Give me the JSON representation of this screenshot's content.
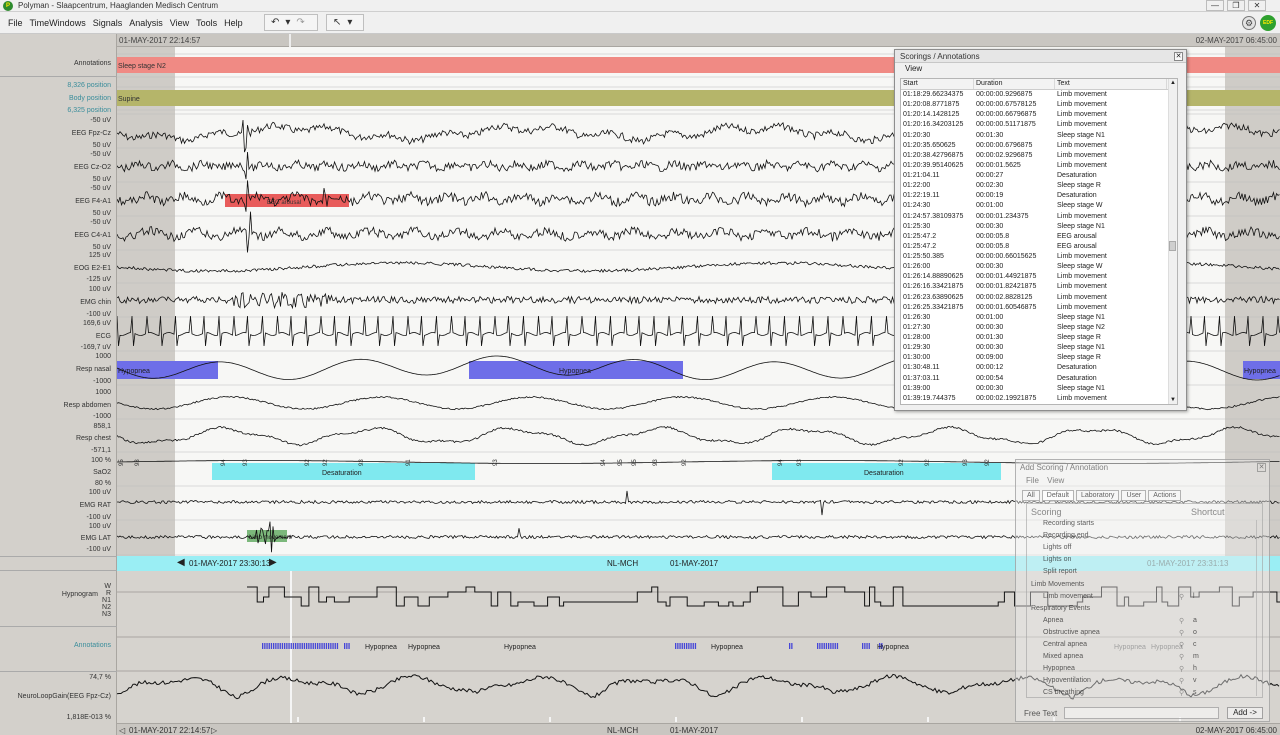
{
  "window": {
    "title": "Polyman - Slaapcentrum, Haaglanden Medisch Centrum",
    "minimize": "—",
    "maximize": "❐",
    "close": "✕"
  },
  "menu": [
    "File",
    "TimeWindows",
    "Signals",
    "Analysis",
    "View",
    "Tools",
    "Help"
  ],
  "toolbar": {
    "undo": "↶",
    "dropdown": "▾",
    "redo": "↷",
    "pointer": "↖"
  },
  "corner": {
    "edf_badge": "EDF",
    "gear": "⚙"
  },
  "timeline": {
    "start": "01-MAY-2017 22:14:57",
    "end": "02-MAY-2017 06:45:00"
  },
  "channels": [
    {
      "name": "Annotations",
      "color": "#3a3a3a"
    },
    {
      "name": "8,326 position",
      "color": "#3a8d9b"
    },
    {
      "name": "Body position",
      "color": "#3a8d9b"
    },
    {
      "name": "6,325 position",
      "color": "#3a8d9b"
    },
    {
      "name": "-50 uV"
    },
    {
      "name": "EEG Fpz-Cz"
    },
    {
      "name": "50 uV"
    },
    {
      "name": "-50 uV"
    },
    {
      "name": "EEG Cz-O2"
    },
    {
      "name": "50 uV"
    },
    {
      "name": "-50 uV"
    },
    {
      "name": "EEG F4-A1"
    },
    {
      "name": "50 uV"
    },
    {
      "name": "-50 uV"
    },
    {
      "name": "EEG C4-A1"
    },
    {
      "name": "50 uV"
    },
    {
      "name": "125 uV"
    },
    {
      "name": "EOG E2-E1"
    },
    {
      "name": "-125 uV"
    },
    {
      "name": "100 uV"
    },
    {
      "name": "EMG chin"
    },
    {
      "name": "-100 uV"
    },
    {
      "name": "169,6 uV"
    },
    {
      "name": "ECG"
    },
    {
      "name": "-169,7 uV"
    },
    {
      "name": "1000"
    },
    {
      "name": "Resp nasal"
    },
    {
      "name": "-1000"
    },
    {
      "name": "1000"
    },
    {
      "name": "Resp abdomen"
    },
    {
      "name": "-1000"
    },
    {
      "name": "858,1"
    },
    {
      "name": "Resp chest"
    },
    {
      "name": "-571,1"
    },
    {
      "name": "100 %"
    },
    {
      "name": "SaO2"
    },
    {
      "name": "80 %"
    },
    {
      "name": "100 uV"
    },
    {
      "name": "EMG RAT"
    },
    {
      "name": "-100 uV"
    },
    {
      "name": "100 uV"
    },
    {
      "name": "EMG LAT"
    },
    {
      "name": "-100 uV"
    }
  ],
  "events": {
    "sleep_stage": "Sleep stage N2",
    "body_position": "Supine",
    "hypopnea": "Hypopnea",
    "desaturation": "Desaturation",
    "eeg_arousal": "EEG arousal",
    "limb_movement": "Limb movement",
    "colors": {
      "stage": "#f08a84",
      "position": "#b5b56a",
      "arousal": "#e64a4a",
      "hypopnea": "#6e6ee8",
      "desat": "#7fe9ef"
    }
  },
  "sao2_values": [
    "95",
    "93",
    "94",
    "93",
    "92",
    "92",
    "93",
    "91",
    "93",
    "94",
    "95",
    "95",
    "93",
    "92",
    "94",
    "93",
    "92",
    "92",
    "93",
    "92"
  ],
  "nav": {
    "left_arrow": "◀",
    "time": "01-MAY-2017 23:30:13",
    "right_arrow": "▶",
    "site": "NL-MCH",
    "date": "01-MAY-2017",
    "end_time": "01-MAY-2017 23:31:13"
  },
  "overview": {
    "hypnogram_label": "Hypnogram",
    "stages": [
      "W",
      "R",
      "N1",
      "N2",
      "N3"
    ],
    "annotations_label": "Annotations",
    "hyp_labels": [
      "Hypopnea",
      "Hypopnea",
      "Hypopnea",
      "Hypopnea",
      "Hypopnea",
      "Hypopnea",
      "Hypopnea"
    ],
    "nlg_max": "74,7 %",
    "nlg_label": "NeuroLoopGain(EEG Fpz-Cz)",
    "nlg_min": "1,818E-013 %"
  },
  "bottom": {
    "left_arrow": "◁",
    "time": "01-MAY-2017 22:14:57",
    "right_arrow": "▷",
    "site": "NL-MCH",
    "date": "01-MAY-2017",
    "end_time": "02-MAY-2017 06:45:00"
  },
  "scorings_dialog": {
    "title": "Scorings / Annotations",
    "menu": "View",
    "close": "✕",
    "columns": [
      "Start",
      "Duration",
      "Text"
    ],
    "rows": [
      [
        "01:18:29.66234375",
        "00:00:00.9296875",
        "Limb movement"
      ],
      [
        "01:20:08.8771875",
        "00:00:00.67578125",
        "Limb movement"
      ],
      [
        "01:20:14.1428125",
        "00:00:00.66796875",
        "Limb movement"
      ],
      [
        "01:20:16.34203125",
        "00:00:00.51171875",
        "Limb movement"
      ],
      [
        "01:20:30",
        "00:01:30",
        "Sleep stage N1"
      ],
      [
        "01:20:35.650625",
        "00:00:00.6796875",
        "Limb movement"
      ],
      [
        "01:20:38.42796875",
        "00:00:02.9296875",
        "Limb movement"
      ],
      [
        "01:20:39.95140625",
        "00:00:01.5625",
        "Limb movement"
      ],
      [
        "01:21:04.11",
        "00:00:27",
        "Desaturation"
      ],
      [
        "01:22:00",
        "00:02:30",
        "Sleep stage R"
      ],
      [
        "01:22:19.11",
        "00:00:19",
        "Desaturation"
      ],
      [
        "01:24:30",
        "00:01:00",
        "Sleep stage W"
      ],
      [
        "01:24:57.38109375",
        "00:00:01.234375",
        "Limb movement"
      ],
      [
        "01:25:30",
        "00:00:30",
        "Sleep stage N1"
      ],
      [
        "01:25:47.2",
        "00:00:05.8",
        "EEG arousal"
      ],
      [
        "01:25:47.2",
        "00:00:05.8",
        "EEG arousal"
      ],
      [
        "01:25:50.385",
        "00:00:00.66015625",
        "Limb movement"
      ],
      [
        "01:26:00",
        "00:00:30",
        "Sleep stage W"
      ],
      [
        "01:26:14.88890625",
        "00:00:01.44921875",
        "Limb movement"
      ],
      [
        "01:26:16.33421875",
        "00:00:01.82421875",
        "Limb movement"
      ],
      [
        "01:26:23.63890625",
        "00:00:02.8828125",
        "Limb movement"
      ],
      [
        "01:26:25.33421875",
        "00:00:01.60546875",
        "Limb movement"
      ],
      [
        "01:26:30",
        "00:01:00",
        "Sleep stage N1"
      ],
      [
        "01:27:30",
        "00:00:30",
        "Sleep stage N2"
      ],
      [
        "01:28:00",
        "00:01:30",
        "Sleep stage R"
      ],
      [
        "01:29:30",
        "00:00:30",
        "Sleep stage N1"
      ],
      [
        "01:30:00",
        "00:09:00",
        "Sleep stage R"
      ],
      [
        "01:30:48.11",
        "00:00:12",
        "Desaturation"
      ],
      [
        "01:37:03.11",
        "00:00:54",
        "Desaturation"
      ],
      [
        "01:39:00",
        "00:00:30",
        "Sleep stage N1"
      ],
      [
        "01:39:19.744375",
        "00:00:02.19921875",
        "Limb movement"
      ]
    ]
  },
  "add_scoring": {
    "title": "Add Scoring / Annotation",
    "close": "✕",
    "menu": [
      "File",
      "View"
    ],
    "tabs": [
      "All",
      "Default",
      "Laboratory",
      "User",
      "Actions"
    ],
    "header_scoring": "Scoring",
    "header_shortcut": "Shortcut",
    "items": [
      {
        "label": "Recording starts",
        "key": ""
      },
      {
        "label": "Recording end",
        "key": ""
      },
      {
        "label": "Lights off",
        "key": ""
      },
      {
        "label": "Lights on",
        "key": ""
      },
      {
        "label": "Split report",
        "key": ""
      },
      {
        "label": "Limb Movements",
        "key": "",
        "group": true
      },
      {
        "label": "Limb movement",
        "key": "l"
      },
      {
        "label": "Respiratory Events",
        "key": "",
        "group": true
      },
      {
        "label": "Apnea",
        "key": "a"
      },
      {
        "label": "Obstructive apnea",
        "key": "o"
      },
      {
        "label": "Central apnea",
        "key": "c"
      },
      {
        "label": "Mixed apnea",
        "key": "m"
      },
      {
        "label": "Hypopnea",
        "key": "h"
      },
      {
        "label": "Hypoventilation",
        "key": "v"
      },
      {
        "label": "CS breathing",
        "key": "s"
      }
    ],
    "free_text_label": "Free Text",
    "add_button": "Add ->"
  }
}
